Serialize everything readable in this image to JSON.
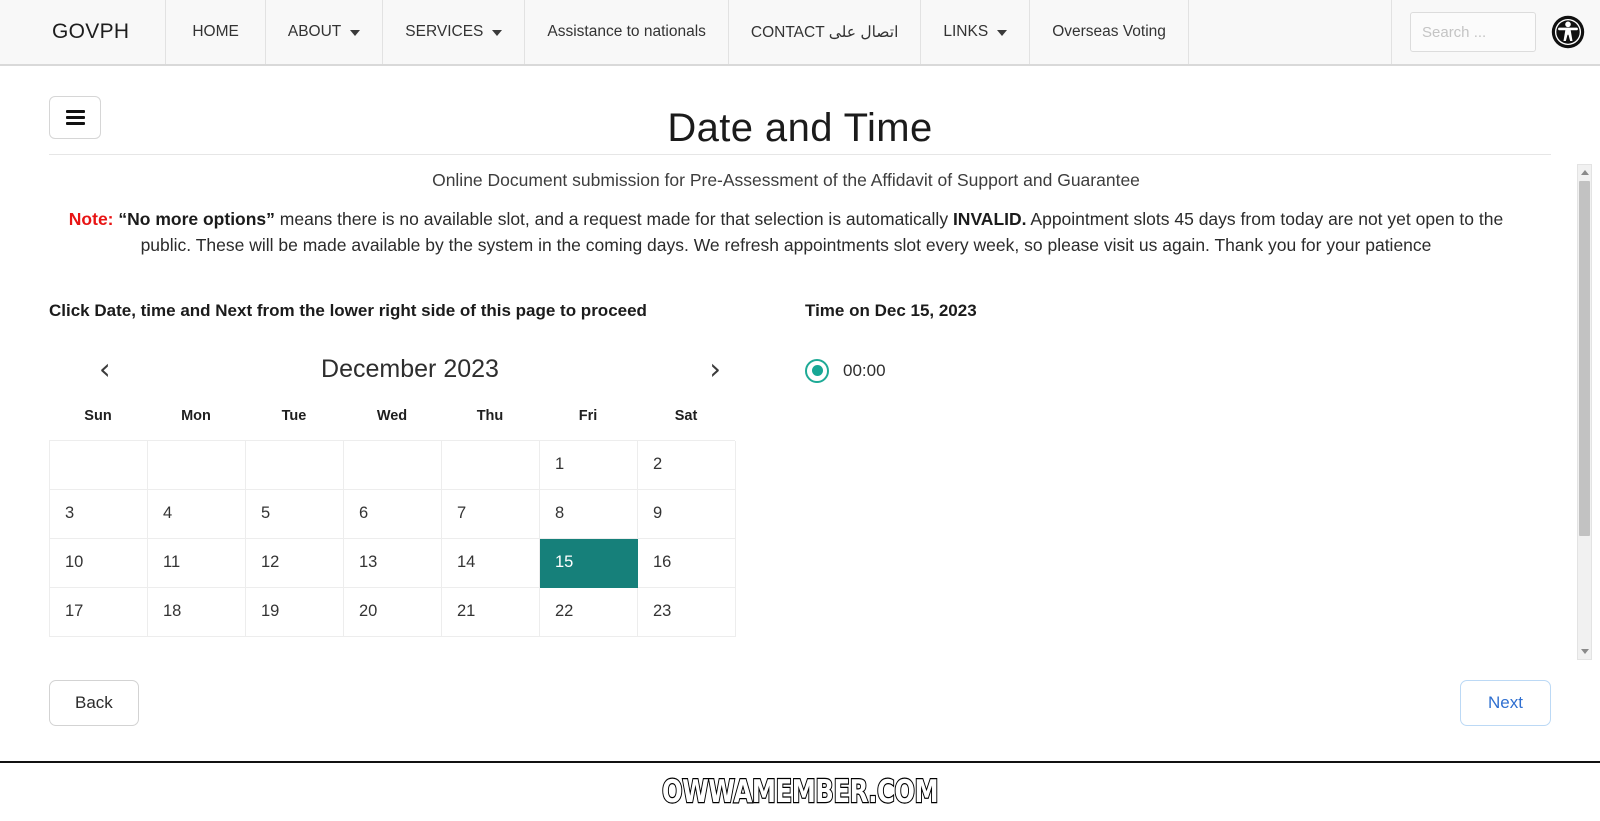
{
  "navbar": {
    "brand": "GOVPH",
    "items": [
      {
        "label": "HOME",
        "has_caret": false
      },
      {
        "label": "ABOUT",
        "has_caret": true
      },
      {
        "label": "SERVICES",
        "has_caret": true
      },
      {
        "label": "Assistance to nationals",
        "has_caret": false
      },
      {
        "label": "CONTACT اتصال على",
        "has_caret": false
      },
      {
        "label": "LINKS",
        "has_caret": true
      },
      {
        "label": "Overseas Voting",
        "has_caret": false
      }
    ],
    "search_placeholder": "Search ...",
    "accessibility_icon": "accessibility-icon"
  },
  "header": {
    "menu_icon": "hamburger-icon",
    "title": "Date and Time"
  },
  "content": {
    "subtitle": "Online Document submission for Pre-Assessment of the Affidavit of Support and Guarantee",
    "note_label": "Note:",
    "note_quoted": "“No more options”",
    "note_part1": " means there is no available slot, and a request made for that selection is automatically ",
    "note_bold2": "INVALID.",
    "note_part2": " Appointment slots 45 days from today are not yet open to the public. These will be made available by the system in the coming days. We refresh appointments slot every week, so please visit us again. Thank you for your patience"
  },
  "calendar": {
    "instruction": "Click Date, time and Next from the lower right side of this page to proceed",
    "prev_icon": "chevron-left-icon",
    "next_icon": "chevron-right-icon",
    "month_label": "December 2023",
    "weekdays": [
      "Sun",
      "Mon",
      "Tue",
      "Wed",
      "Thu",
      "Fri",
      "Sat"
    ],
    "selected_day": 15,
    "selected_color": "#16807a",
    "weeks": [
      [
        "",
        "",
        "",
        "",
        "",
        "1",
        "2"
      ],
      [
        "3",
        "4",
        "5",
        "6",
        "7",
        "8",
        "9"
      ],
      [
        "10",
        "11",
        "12",
        "13",
        "14",
        "15",
        "16"
      ],
      [
        "17",
        "18",
        "19",
        "20",
        "21",
        "22",
        "23"
      ]
    ]
  },
  "time_panel": {
    "title": "Time on Dec 15, 2023",
    "options": [
      {
        "label": "00:00",
        "selected": true
      }
    ],
    "radio_color": "#17a795"
  },
  "actions": {
    "back_label": "Back",
    "next_label": "Next"
  },
  "scrollbar": {
    "up_icon": "scroll-up-arrow-icon",
    "down_icon": "scroll-down-arrow-icon"
  },
  "footer": {
    "watermark": "OWWAMEMBER.COM"
  }
}
